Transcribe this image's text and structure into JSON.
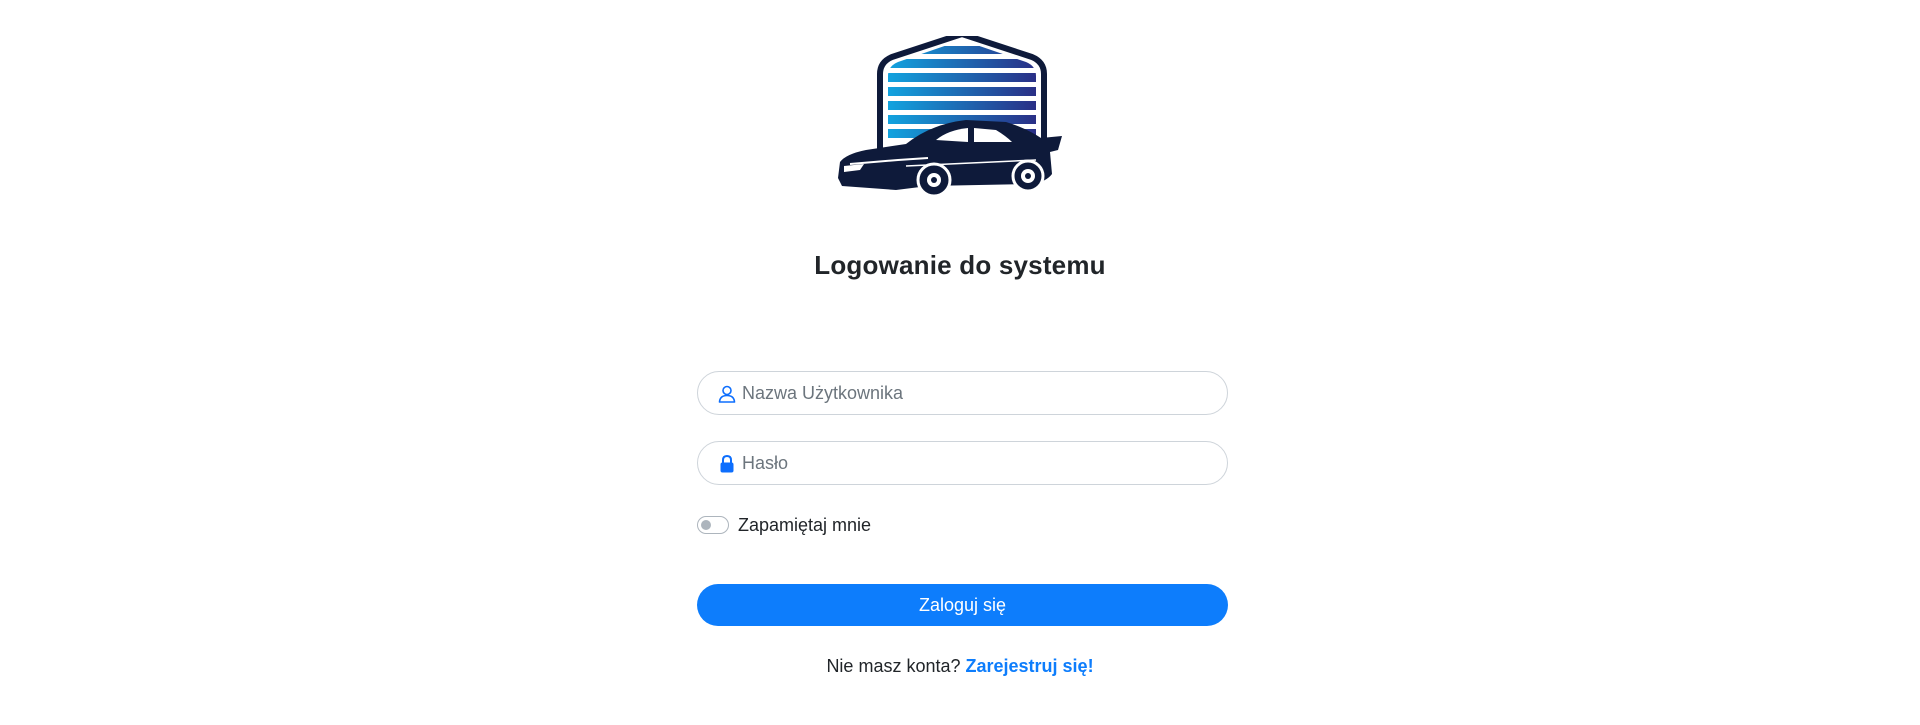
{
  "page": {
    "title": "Logowanie do systemu"
  },
  "form": {
    "username_placeholder": "Nazwa Użytkownika",
    "username_value": "",
    "password_placeholder": "Hasło",
    "password_value": "",
    "remember_label": "Zapamiętaj mnie",
    "remember_checked": false,
    "submit_label": "Zaloguj się"
  },
  "footer": {
    "prompt": "Nie masz konta?",
    "register_link": "Zarejestruj się!"
  },
  "icons": {
    "logo": "garage-car-logo",
    "username": "user-icon",
    "password": "lock-icon"
  },
  "colors": {
    "accent": "#0d7dfc",
    "logo_dark": "#0e1a3a",
    "logo_gradient_start": "#12a3df",
    "logo_gradient_end": "#2a2f86"
  }
}
